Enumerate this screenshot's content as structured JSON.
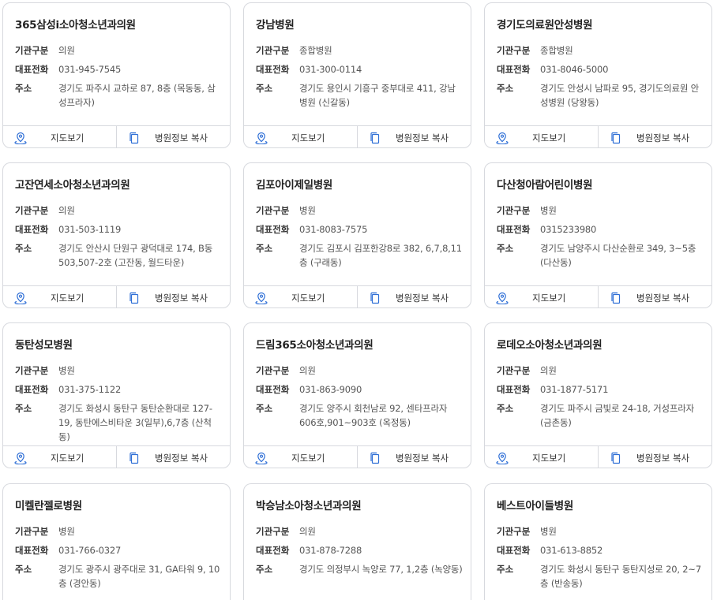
{
  "labels": {
    "type": "기관구분",
    "phone": "대표전화",
    "address": "주소",
    "map_button": "지도보기",
    "copy_button": "병원정보 복사"
  },
  "hospitals": [
    {
      "name": "365삼성i소아청소년과의원",
      "type": "의원",
      "phone": "031-945-7545",
      "address": "경기도 파주시 교하로 87, 8층 (목동동, 삼성프라자)"
    },
    {
      "name": "강남병원",
      "type": "종합병원",
      "phone": "031-300-0114",
      "address": "경기도 용인시 기흥구 중부대로 411, 강남병원 (신갈동)"
    },
    {
      "name": "경기도의료원안성병원",
      "type": "종합병원",
      "phone": "031-8046-5000",
      "address": "경기도 안성시 남파로 95, 경기도의료원 안성병원 (당왕동)"
    },
    {
      "name": "고잔연세소아청소년과의원",
      "type": "의원",
      "phone": "031-503-1119",
      "address": "경기도 안산시 단원구 광덕대로 174, B동 503,507-2호 (고잔동, 월드타운)"
    },
    {
      "name": "김포아이제일병원",
      "type": "병원",
      "phone": "031-8083-7575",
      "address": "경기도 김포시 김포한강8로 382, 6,7,8,11층 (구래동)"
    },
    {
      "name": "다산청아람어린이병원",
      "type": "병원",
      "phone": "0315233980",
      "address": "경기도 남양주시 다산순환로 349, 3~5층 (다산동)"
    },
    {
      "name": "동탄성모병원",
      "type": "병원",
      "phone": "031-375-1122",
      "address": "경기도 화성시 동탄구 동탄순환대로 127-19, 동탄에스비타운 3(일부),6,7층 (산척동)"
    },
    {
      "name": "드림365소아청소년과의원",
      "type": "의원",
      "phone": "031-863-9090",
      "address": "경기도 양주시 회천남로 92, 센타프라자 606호,901~903호 (옥정동)"
    },
    {
      "name": "로데오소아청소년과의원",
      "type": "의원",
      "phone": "031-1877-5171",
      "address": "경기도 파주시 금빛로 24-18, 거성프라자 (금촌동)"
    },
    {
      "name": "미켈란젤로병원",
      "type": "병원",
      "phone": "031-766-0327",
      "address": "경기도 광주시 광주대로 31, GA타워 9, 10층 (경안동)"
    },
    {
      "name": "박승남소아청소년과의원",
      "type": "의원",
      "phone": "031-878-7288",
      "address": "경기도 의정부시 녹양로 77, 1,2층 (녹양동)"
    },
    {
      "name": "베스트아이들병원",
      "type": "병원",
      "phone": "031-613-8852",
      "address": "경기도 화성시 동탄구 동탄지성로 20, 2~7층 (반송동)"
    }
  ]
}
